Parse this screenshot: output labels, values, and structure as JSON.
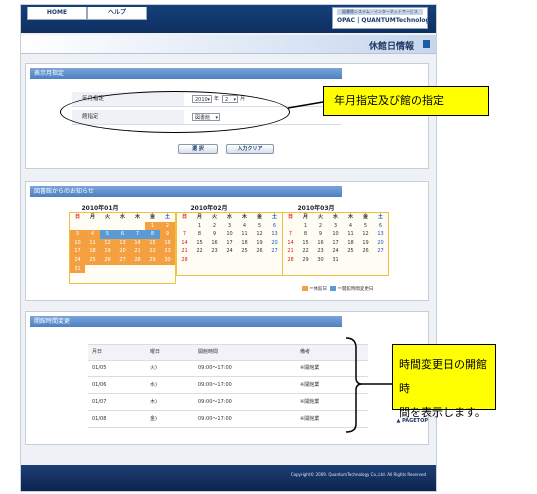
{
  "nav": {
    "home": "HOME",
    "help": "ヘルプ"
  },
  "brand": {
    "tagline": "図書館システム・インターネットサービス",
    "name": "OPAC | QUANTUMTechnology"
  },
  "page_title": "休館日情報",
  "month_panel": {
    "header": "表示月指定",
    "year_month_label": "年月指定",
    "year_value": "2010",
    "year_unit": "年",
    "month_value": "2",
    "month_unit": "月",
    "library_label": "館指定",
    "library_value": "図書館",
    "select_button": "選 択",
    "clear_button": "入力クリア"
  },
  "notice_panel": {
    "header": "図書館からのお知らせ",
    "calendars": [
      {
        "title": "2010年01月",
        "weekdays": [
          "日",
          "月",
          "火",
          "水",
          "木",
          "金",
          "土"
        ],
        "days": [
          "",
          "",
          "",
          "",
          "",
          "1",
          "2",
          "3",
          "4",
          "5",
          "6",
          "7",
          "8",
          "9",
          "10",
          "11",
          "12",
          "13",
          "14",
          "15",
          "16",
          "17",
          "18",
          "19",
          "20",
          "21",
          "22",
          "23",
          "24",
          "25",
          "26",
          "27",
          "28",
          "29",
          "30",
          "31"
        ],
        "closed": [
          "1",
          "2",
          "3",
          "4",
          "5",
          "6",
          "7",
          "8",
          "9",
          "10",
          "11",
          "12",
          "13",
          "14",
          "15",
          "16",
          "17",
          "18",
          "19",
          "20",
          "21",
          "22",
          "23",
          "24",
          "25",
          "26",
          "27",
          "28",
          "29",
          "30",
          "31"
        ]
      },
      {
        "title": "2010年02月",
        "weekdays": [
          "日",
          "月",
          "火",
          "水",
          "木",
          "金",
          "土"
        ],
        "days": [
          "",
          "1",
          "2",
          "3",
          "4",
          "5",
          "6",
          "7",
          "8",
          "9",
          "10",
          "11",
          "12",
          "13",
          "14",
          "15",
          "16",
          "17",
          "18",
          "19",
          "20",
          "21",
          "22",
          "23",
          "24",
          "25",
          "26",
          "27",
          "28"
        ]
      },
      {
        "title": "2010年03月",
        "weekdays": [
          "日",
          "月",
          "火",
          "水",
          "木",
          "金",
          "土"
        ],
        "days": [
          "",
          "1",
          "2",
          "3",
          "4",
          "5",
          "6",
          "7",
          "8",
          "9",
          "10",
          "11",
          "12",
          "13",
          "14",
          "15",
          "16",
          "17",
          "18",
          "19",
          "20",
          "21",
          "22",
          "23",
          "24",
          "25",
          "26",
          "27",
          "28",
          "29",
          "30",
          "31"
        ]
      }
    ],
    "legend": {
      "closed": "＝休館日",
      "changed": "＝開館時間変更日"
    }
  },
  "hours_panel": {
    "header": "開館時間変更",
    "columns": [
      "月日",
      "曜日",
      "開館時間",
      "備考"
    ],
    "rows": [
      {
        "date": "01/05",
        "weekday": "火)",
        "time": "09:00〜17:00",
        "note": "※開館業"
      },
      {
        "date": "01/06",
        "weekday": "水)",
        "time": "09:00〜17:00",
        "note": "※開館業"
      },
      {
        "date": "01/07",
        "weekday": "木)",
        "time": "09:00〜17:00",
        "note": "※開館業"
      },
      {
        "date": "01/08",
        "weekday": "金)",
        "time": "09:00〜17:00",
        "note": "※開館業"
      }
    ]
  },
  "pagetop": "▲ PAGETOP",
  "copyright": "Copyright© 2009. QuantumTechnology Co.,Ltd. All Rights Reserved",
  "annotations": {
    "month_note": "年月指定及び館の指定",
    "hours_note_line1": "時間変更日の開館時",
    "hours_note_line2": "間を表示します。"
  },
  "colors": {
    "closed": "#f5a040",
    "changed": "#5b9bd5",
    "callout": "#ffff00",
    "header_blue": "#15407a"
  }
}
